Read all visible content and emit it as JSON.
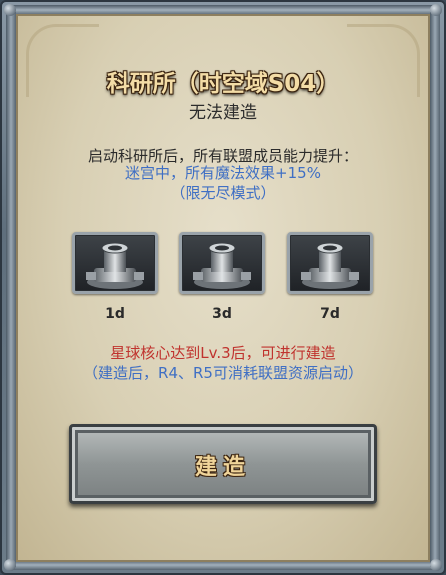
{
  "dialog": {
    "title": "科研所（时空域S04）",
    "status": "无法建造"
  },
  "description": {
    "line1": "启动科研所后，所有联盟成员能力提升：",
    "line2": "迷宫中，所有魔法效果+15%",
    "line3": "（限无尽模式）"
  },
  "options": [
    {
      "duration": "1d",
      "icon": "tower-icon"
    },
    {
      "duration": "3d",
      "icon": "tower-icon"
    },
    {
      "duration": "7d",
      "icon": "tower-icon"
    }
  ],
  "requirement": {
    "line1": "星球核心达到Lv.3后，可进行建造",
    "line2": "（建造后，R4、R5可消耗联盟资源启动）"
  },
  "build_button": {
    "label": "建造"
  },
  "colors": {
    "blue_text": "#3f6fc4",
    "red_text": "#c0332e",
    "title_gold": "#f3dca6"
  }
}
